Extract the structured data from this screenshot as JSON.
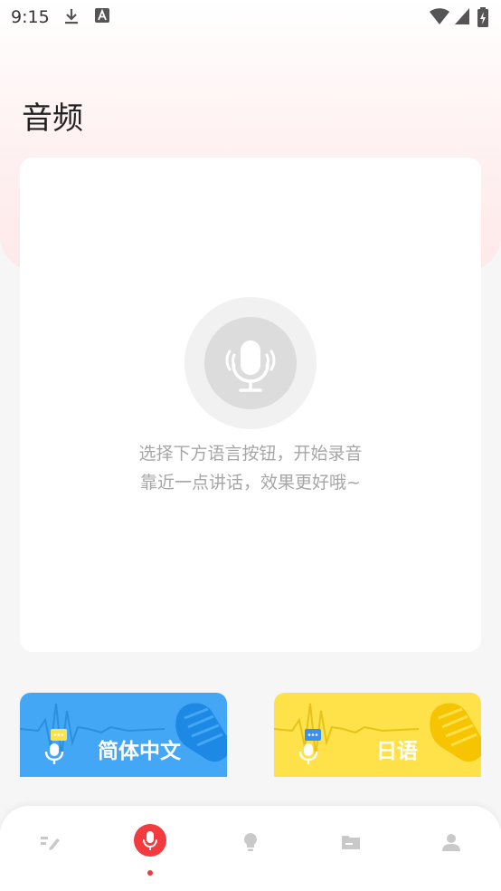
{
  "status": {
    "time": "9:15"
  },
  "page": {
    "title": "音频"
  },
  "empty_state": {
    "line1": "选择下方语言按钮，开始录音",
    "line2": "靠近一点讲话，效果更好哦~"
  },
  "languages": [
    {
      "label": "简体中文",
      "color": "#44a7f5"
    },
    {
      "label": "日语",
      "color": "#ffe14a"
    }
  ],
  "nav": [
    {
      "name": "edit",
      "icon": "pencil-icon",
      "active": false
    },
    {
      "name": "record",
      "icon": "microphone-icon",
      "active": true
    },
    {
      "name": "ideas",
      "icon": "lightbulb-icon",
      "active": false
    },
    {
      "name": "files",
      "icon": "folder-icon",
      "active": false
    },
    {
      "name": "profile",
      "icon": "person-icon",
      "active": false
    }
  ],
  "colors": {
    "accent": "#f23a3f",
    "blue": "#44a7f5",
    "yellow": "#ffe14a"
  }
}
